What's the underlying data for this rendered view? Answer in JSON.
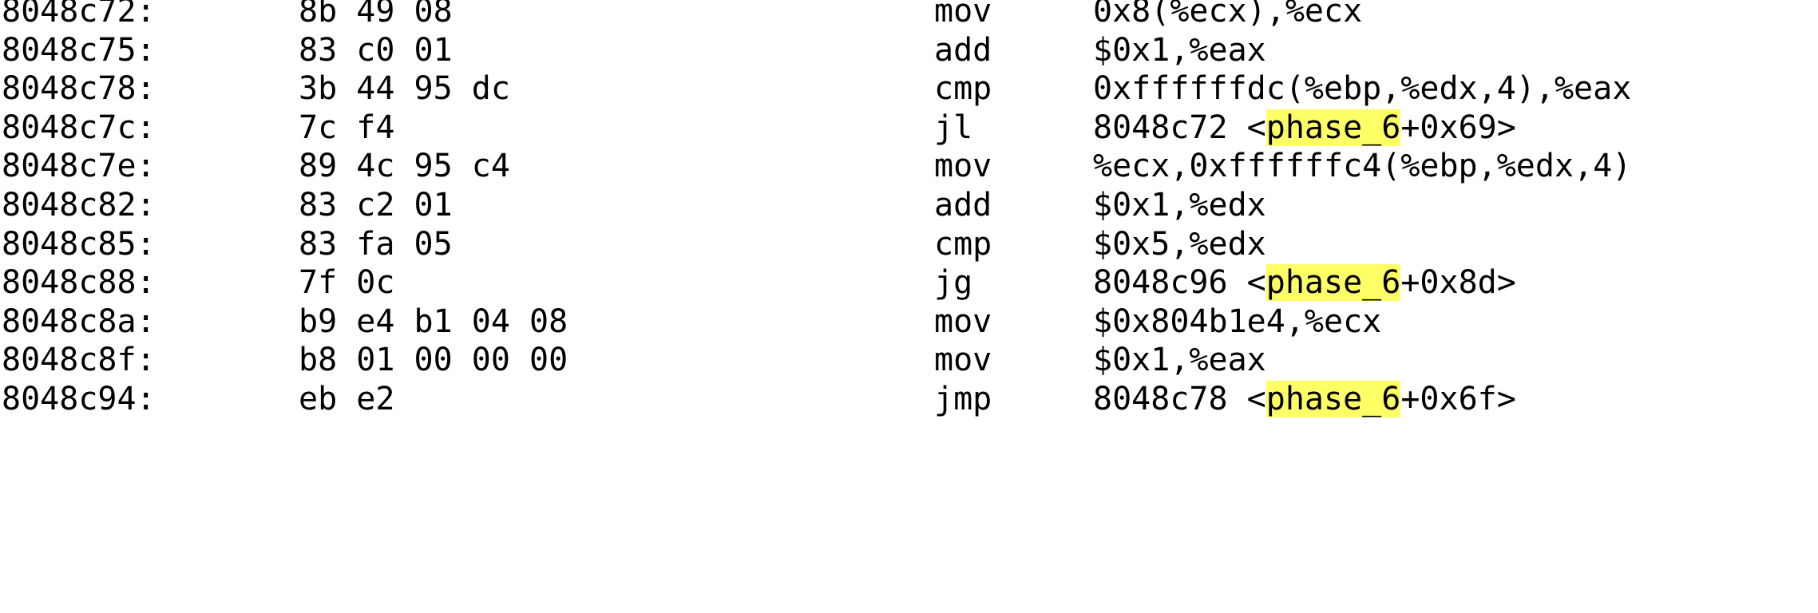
{
  "highlight_color": "#ffff66",
  "rows": [
    {
      "addr": "8048c72:",
      "bytes": "8b 49 08",
      "mnem": "mov",
      "ops": "0x8(%ecx),%ecx"
    },
    {
      "addr": "8048c75:",
      "bytes": "83 c0 01",
      "mnem": "add",
      "ops": "$0x1,%eax"
    },
    {
      "addr": "8048c78:",
      "bytes": "3b 44 95 dc",
      "mnem": "cmp",
      "ops": "0xffffffdc(%ebp,%edx,4),%eax"
    },
    {
      "addr": "8048c7c:",
      "bytes": "7c f4",
      "mnem": "jl",
      "ops_pre": "8048c72 <",
      "ops_hl": "phase_6",
      "ops_post": "+0x69>"
    },
    {
      "addr": "8048c7e:",
      "bytes": "89 4c 95 c4",
      "mnem": "mov",
      "ops": "%ecx,0xffffffc4(%ebp,%edx,4)"
    },
    {
      "addr": "8048c82:",
      "bytes": "83 c2 01",
      "mnem": "add",
      "ops": "$0x1,%edx"
    },
    {
      "addr": "8048c85:",
      "bytes": "83 fa 05",
      "mnem": "cmp",
      "ops": "$0x5,%edx"
    },
    {
      "addr": "8048c88:",
      "bytes": "7f 0c",
      "mnem": "jg",
      "ops_pre": "8048c96 <",
      "ops_hl": "phase_6",
      "ops_post": "+0x8d>"
    },
    {
      "addr": "8048c8a:",
      "bytes": "b9 e4 b1 04 08",
      "mnem": "mov",
      "ops": "$0x804b1e4,%ecx"
    },
    {
      "addr": "8048c8f:",
      "bytes": "b8 01 00 00 00",
      "mnem": "mov",
      "ops": "$0x1,%eax"
    },
    {
      "addr": "8048c94:",
      "bytes": "eb e2",
      "mnem": "jmp",
      "ops_pre": "8048c78 <",
      "ops_hl": "phase_6",
      "ops_post": "+0x6f>"
    }
  ]
}
